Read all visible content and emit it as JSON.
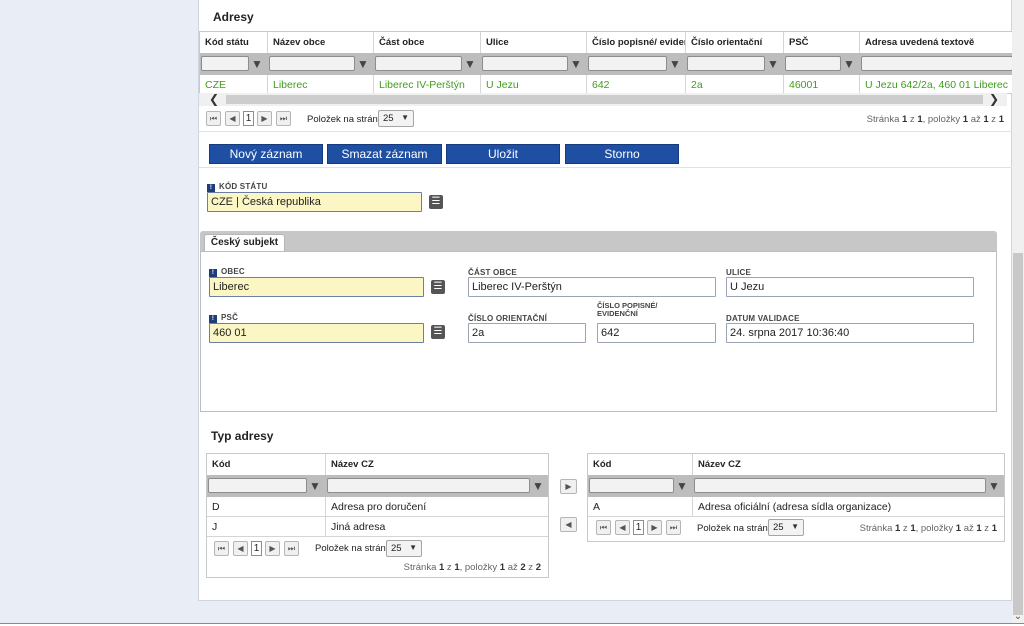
{
  "adresy": {
    "title": "Adresy",
    "columns": [
      "Kód státu",
      "Název obce",
      "Část obce",
      "Ulice",
      "Číslo popisné/ evidenční",
      "Číslo orientační",
      "PSČ",
      "Adresa uvedená textově"
    ],
    "row": [
      "CZE",
      "Liberec",
      "Liberec IV-Perštýn",
      "U Jezu",
      "642",
      "2a",
      "46001",
      "U Jezu 642/2a, 460 01 Liberec"
    ],
    "pager": {
      "page": "1",
      "per_page_label": "Položek na stránku",
      "per_page": "25",
      "info_parts": [
        "Stránka ",
        "1",
        " z ",
        "1",
        ", položky ",
        "1",
        " až ",
        "1",
        " z ",
        "1"
      ]
    }
  },
  "buttons": {
    "new": "Nový záznam",
    "delete": "Smazat záznam",
    "save": "Uložit",
    "cancel": "Storno"
  },
  "form": {
    "kod_statu_label": "Kód státu",
    "kod_statu_value": "CZE | Česká republika",
    "tab_label": "Český subjekt",
    "obec_label": "Obec",
    "obec_value": "Liberec",
    "cast_obce_label": "Část obce",
    "cast_obce_value": "Liberec IV-Perštýn",
    "ulice_label": "Ulice",
    "ulice_value": "U Jezu",
    "psc_label": "PSČ",
    "psc_value": "460 01",
    "cislo_orientacni_label": "Číslo orientační",
    "cislo_orientacni_value": "2a",
    "cislo_popisne_label": "Číslo popisné/ evidenční",
    "cislo_popisne_value": "642",
    "datum_validace_label": "Datum validace",
    "datum_validace_value": "24. srpna 2017 10:36:40"
  },
  "typ_adresy": {
    "title": "Typ adresy",
    "left": {
      "columns": [
        "Kód",
        "Název CZ"
      ],
      "rows": [
        [
          "D",
          "Adresa pro doručení"
        ],
        [
          "J",
          "Jiná adresa"
        ]
      ],
      "pager": {
        "page": "1",
        "per_page_label": "Položek na stránku",
        "per_page": "25",
        "info_parts": [
          "Stránka ",
          "1",
          " z ",
          "1",
          ", položky ",
          "1",
          " až ",
          "2",
          " z ",
          "2"
        ]
      }
    },
    "right": {
      "columns": [
        "Kód",
        "Název CZ"
      ],
      "rows": [
        [
          "A",
          "Adresa oficiální (adresa sídla organizace)"
        ]
      ],
      "pager": {
        "page": "1",
        "per_page_label": "Položek na stránku",
        "per_page": "25",
        "info_parts": [
          "Stránka ",
          "1",
          " z ",
          "1",
          ", položky ",
          "1",
          " až ",
          "1",
          " z ",
          "1"
        ]
      }
    }
  },
  "icons": {
    "filter": "filter-icon",
    "list": "list-icon",
    "required": "required-icon"
  },
  "colors": {
    "button_blue": "#1f4fa3",
    "required_field": "#fbf6c4",
    "selected_row_text": "#3f9e1b"
  }
}
